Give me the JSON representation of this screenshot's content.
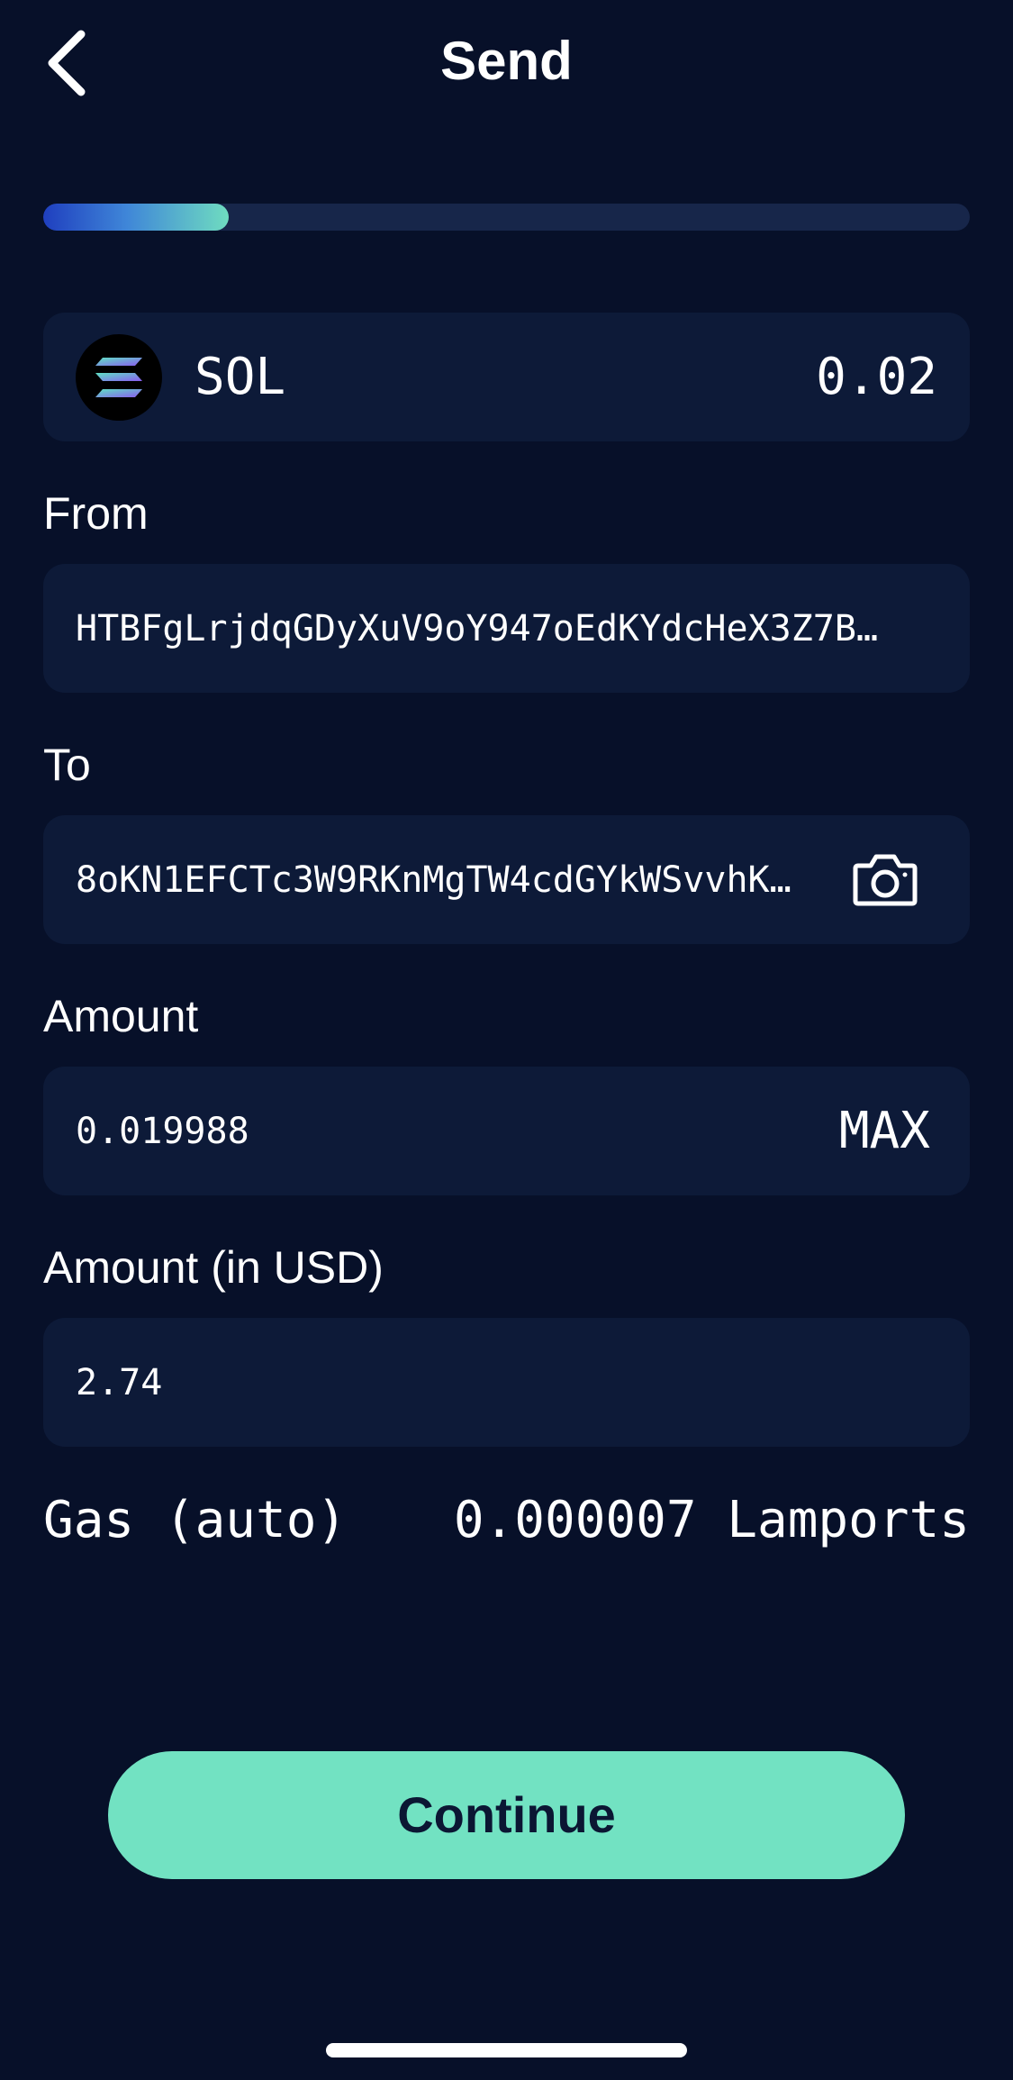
{
  "header": {
    "title": "Send",
    "back_icon": "chevron-left-icon"
  },
  "progress": {
    "value_percent": 20,
    "gradient_start": "#1f3fbf",
    "gradient_end": "#6fdcc0"
  },
  "token": {
    "symbol": "SOL",
    "balance": "0.02",
    "icon": "solana-logo-icon"
  },
  "from": {
    "label": "From",
    "value": "HTBFgLrjdqGDyXuV9oY947oEdKYdcHeX3Z7B…"
  },
  "to": {
    "label": "To",
    "value": "8oKN1EFCTc3W9RKnMgTW4cdGYkWSvvhK…",
    "camera_icon": "camera-icon"
  },
  "amount": {
    "label": "Amount",
    "value": "0.019988",
    "max_label": "MAX"
  },
  "amount_usd": {
    "label": "Amount (in USD)",
    "value": "2.74"
  },
  "gas": {
    "label": "Gas (auto)",
    "value": "0.000007 Lamports"
  },
  "actions": {
    "continue_label": "Continue"
  },
  "colors": {
    "background": "#071029",
    "card": "#0d1a38",
    "accent": "#72e2c2",
    "button_text": "#0b1633"
  }
}
